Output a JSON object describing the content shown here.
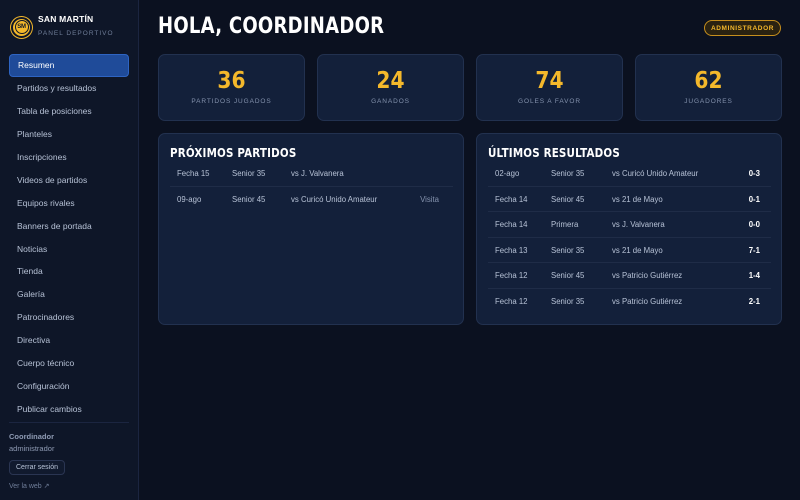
{
  "brand": {
    "name": "SAN MARTÍN",
    "subtitle": "PANEL DEPORTIVO",
    "logo_text": "SM"
  },
  "sidebar": {
    "items": [
      {
        "label": "Resumen",
        "active": true
      },
      {
        "label": "Partidos y resultados"
      },
      {
        "label": "Tabla de posiciones"
      },
      {
        "label": "Planteles"
      },
      {
        "label": "Inscripciones"
      },
      {
        "label": "Videos de partidos"
      },
      {
        "label": "Equipos rivales"
      },
      {
        "label": "Banners de portada"
      },
      {
        "label": "Noticias"
      },
      {
        "label": "Tienda"
      },
      {
        "label": "Galería"
      },
      {
        "label": "Patrocinadores"
      },
      {
        "label": "Directiva"
      },
      {
        "label": "Cuerpo técnico"
      },
      {
        "label": "Configuración"
      },
      {
        "label": "Publicar cambios"
      }
    ],
    "user_name": "Coordinador",
    "user_role": "administrador",
    "logout_label": "Cerrar sesión",
    "view_web_label": "Ver la web ↗"
  },
  "header": {
    "title": "HOLA, COORDINADOR",
    "role_badge": "ADMINISTRADOR"
  },
  "stats": [
    {
      "value": "36",
      "label": "PARTIDOS JUGADOS"
    },
    {
      "value": "24",
      "label": "GANADOS"
    },
    {
      "value": "74",
      "label": "GOLES A FAVOR"
    },
    {
      "value": "62",
      "label": "JUGADORES"
    }
  ],
  "upcoming": {
    "title": "PRÓXIMOS PARTIDOS",
    "rows": [
      {
        "date": "Fecha 15",
        "category": "Senior 35",
        "opponent": "vs J. Valvanera",
        "venue": ""
      },
      {
        "date": "09-ago",
        "category": "Senior 45",
        "opponent": "vs Curicó Unido Amateur",
        "venue": "Visita"
      }
    ]
  },
  "results": {
    "title": "ÚLTIMOS RESULTADOS",
    "rows": [
      {
        "date": "02-ago",
        "category": "Senior 35",
        "opponent": "vs Curicó Unido Amateur",
        "score": "0-3"
      },
      {
        "date": "Fecha 14",
        "category": "Senior 45",
        "opponent": "vs 21 de Mayo",
        "score": "0-1"
      },
      {
        "date": "Fecha 14",
        "category": "Primera",
        "opponent": "vs J. Valvanera",
        "score": "0-0"
      },
      {
        "date": "Fecha 13",
        "category": "Senior 35",
        "opponent": "vs 21 de Mayo",
        "score": "7-1"
      },
      {
        "date": "Fecha 12",
        "category": "Senior 45",
        "opponent": "vs Patricio Gutiérrez",
        "score": "1-4"
      },
      {
        "date": "Fecha 12",
        "category": "Senior 35",
        "opponent": "vs Patricio Gutiérrez",
        "score": "2-1"
      }
    ]
  },
  "colors": {
    "accent": "#f4b82b",
    "active_nav": "#1f4b99",
    "background": "#0b1120",
    "card": "#13203a"
  }
}
